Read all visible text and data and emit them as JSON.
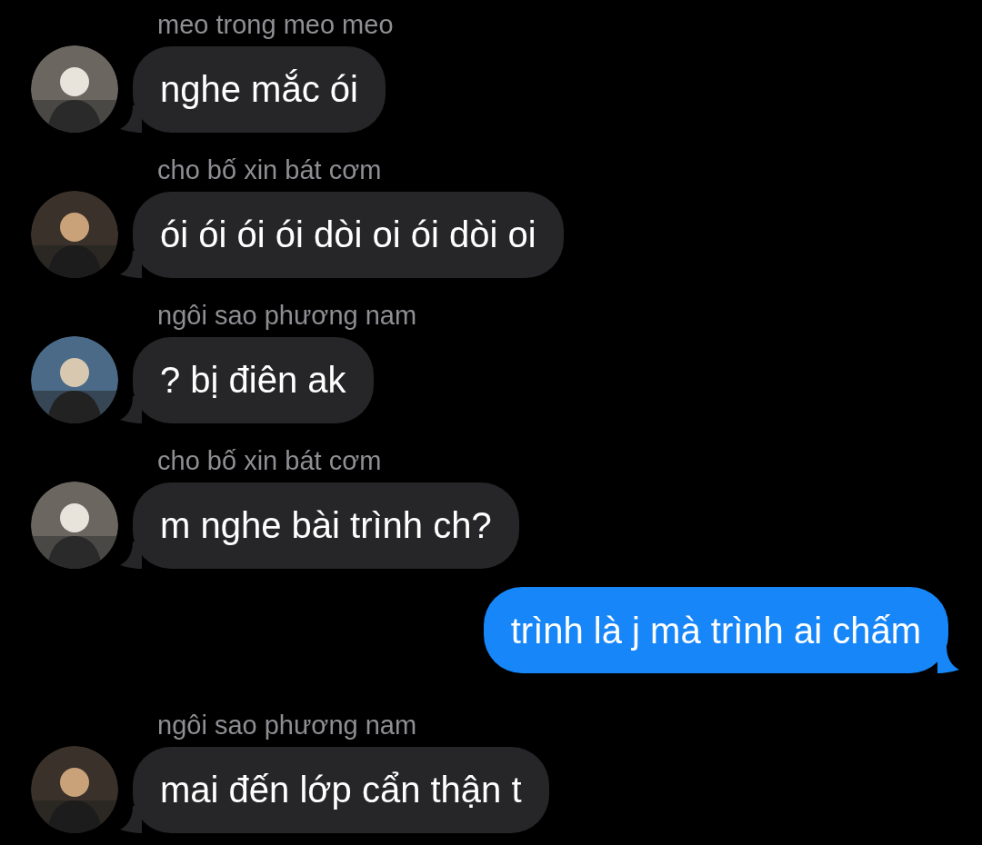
{
  "messages": [
    {
      "kind": "incoming",
      "sender": "meo trong meo meo",
      "text": "nghe mắc ói"
    },
    {
      "kind": "incoming",
      "sender": "cho bố xin bát cơm",
      "text": "ói ói ói ói dòi oi ói dòi oi"
    },
    {
      "kind": "incoming",
      "sender": "ngôi sao phương nam",
      "text": "? bị điên ak"
    },
    {
      "kind": "incoming",
      "sender": "cho bố xin bát cơm",
      "text": "m nghe bài trình ch?"
    },
    {
      "kind": "outgoing",
      "text": "trình là j mà trình ai chấm"
    },
    {
      "kind": "incoming",
      "sender": "ngôi sao phương nam",
      "text": "mai đến lớp cẩn thận t"
    }
  ]
}
